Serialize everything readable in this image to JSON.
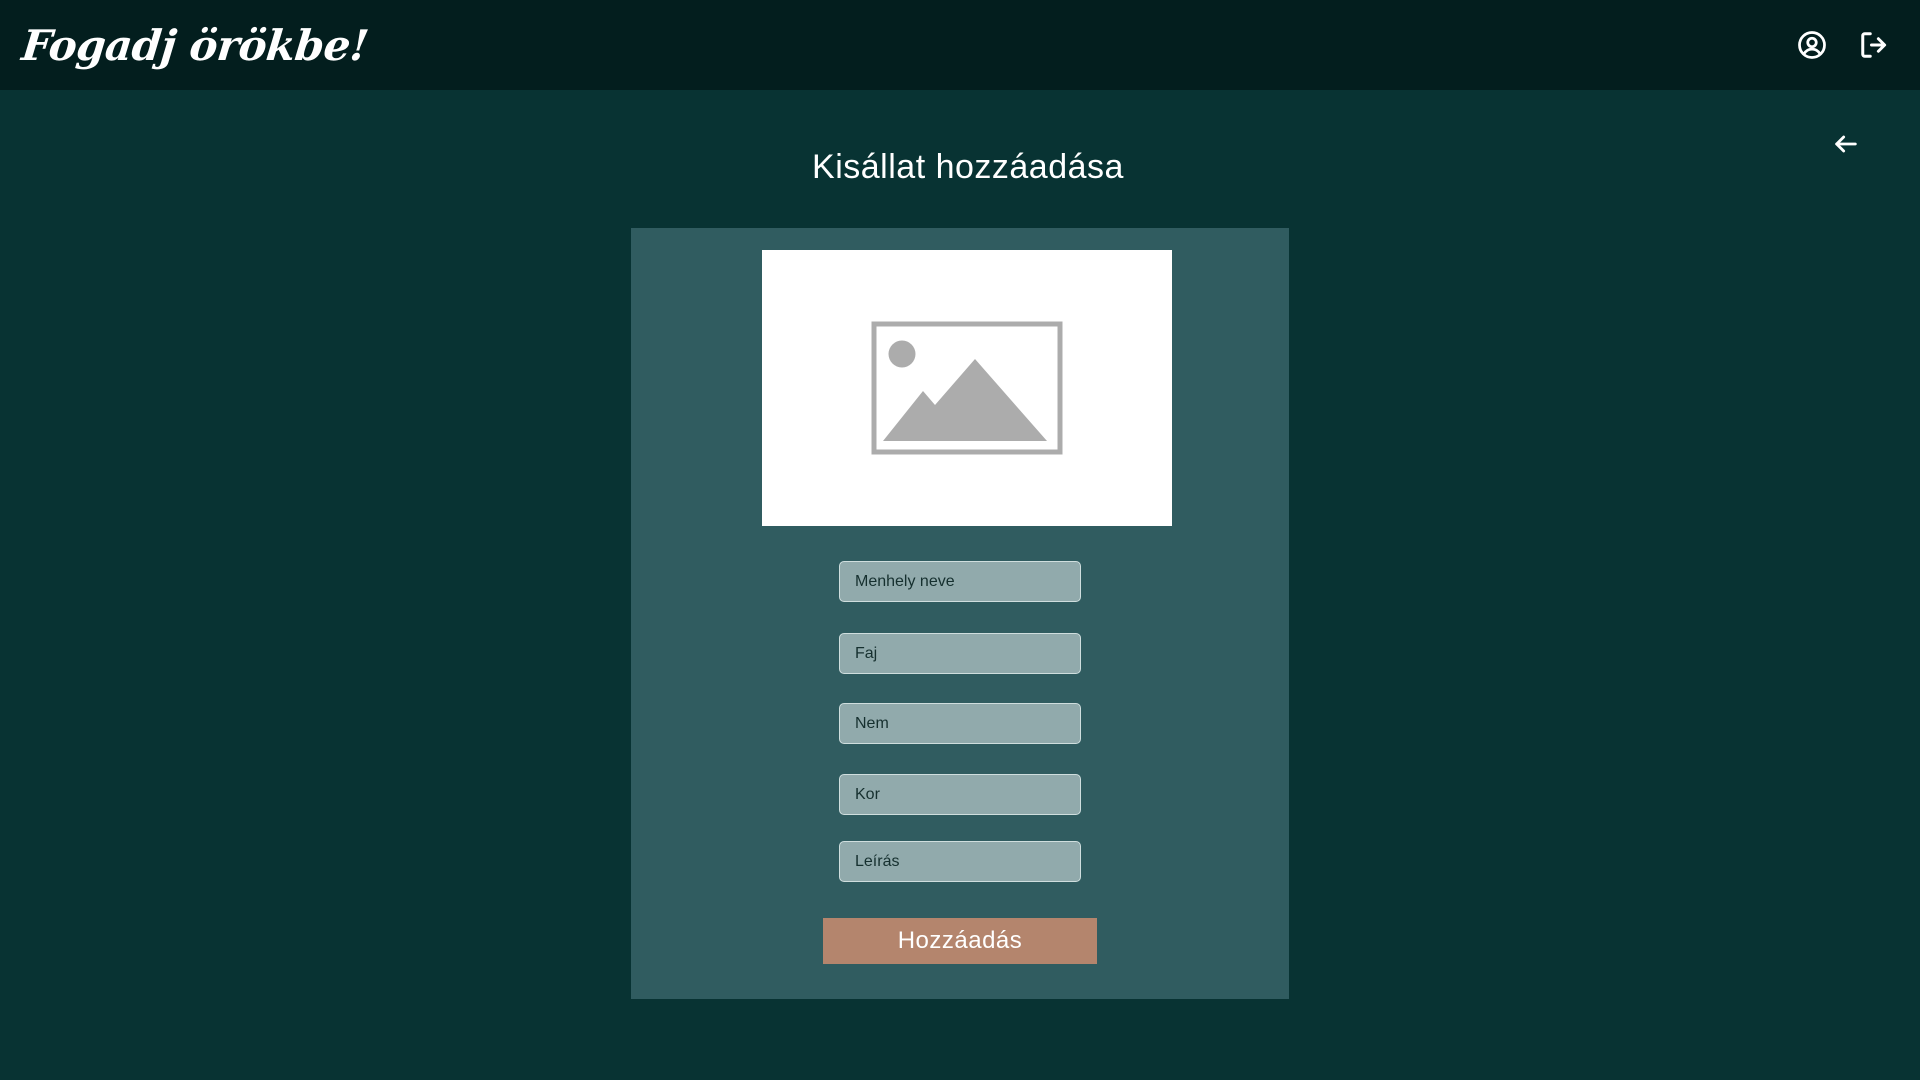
{
  "header": {
    "logo_text": "Fogadj örökbe!",
    "profile_icon": "user-circle-icon",
    "logout_icon": "logout-icon"
  },
  "navigation": {
    "back_icon": "arrow-left-icon"
  },
  "main": {
    "title": "Kisállat hozzáadása",
    "image_placeholder_icon": "image-placeholder-icon",
    "fields": {
      "shelter_name": {
        "value": "",
        "placeholder": "Menhely neve"
      },
      "species": {
        "value": "",
        "placeholder": "Faj"
      },
      "sex": {
        "value": "",
        "placeholder": "Nem"
      },
      "age": {
        "value": "",
        "placeholder": "Kor"
      },
      "description": {
        "value": "",
        "placeholder": "Leírás"
      }
    },
    "submit_label": "Hozzáadás"
  },
  "colors": {
    "header_bg": "#031e1e",
    "page_bg": "#083333",
    "card_bg": "#305c60",
    "input_bg": "#91aaac",
    "button_bg": "#b4856d"
  }
}
